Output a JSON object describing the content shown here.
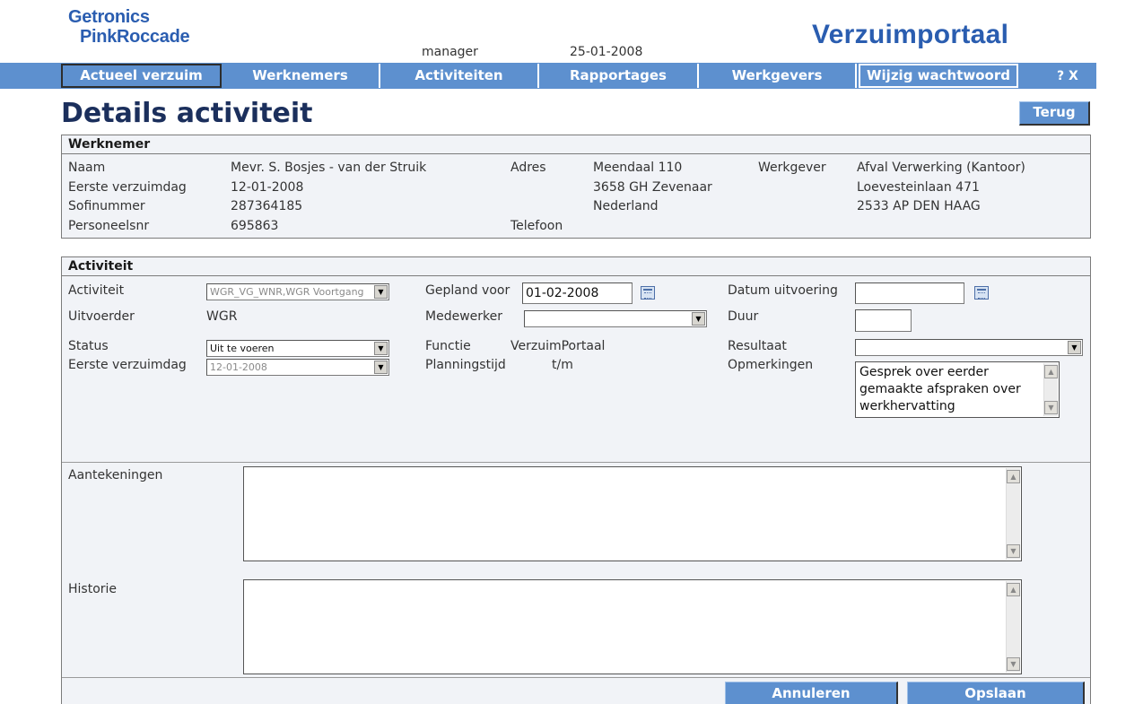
{
  "header": {
    "logo_line1": "Getronics",
    "logo_line2": "PinkRoccade",
    "user": "manager",
    "date": "25-01-2008",
    "portal_title": "Verzuimportaal"
  },
  "nav": {
    "items": [
      {
        "label": "Actueel verzuim"
      },
      {
        "label": "Werknemers"
      },
      {
        "label": "Activiteiten"
      },
      {
        "label": "Rapportages"
      },
      {
        "label": "Werkgevers"
      },
      {
        "label": "Wijzig wachtwoord"
      }
    ],
    "help_close": "? X"
  },
  "page": {
    "title": "Details activiteit",
    "back_label": "Terug"
  },
  "werknemer": {
    "heading": "Werknemer",
    "labels": {
      "naam": "Naam",
      "eerste_verzuimdag": "Eerste verzuimdag",
      "sofinummer": "Sofinummer",
      "personeelsnr": "Personeelsnr",
      "adres": "Adres",
      "telefoon": "Telefoon",
      "werkgever": "Werkgever"
    },
    "values": {
      "naam": "Mevr. S. Bosjes - van der Struik",
      "eerste_verzuimdag": "12-01-2008",
      "sofinummer": "287364185",
      "personeelsnr": "695863",
      "adres_line1": "Meendaal 110",
      "adres_line2": "3658 GH Zevenaar",
      "adres_line3": "Nederland",
      "werkgever_line1": "Afval Verwerking (Kantoor)",
      "werkgever_line2": "Loevesteinlaan 471",
      "werkgever_line3": "2533 AP DEN HAAG"
    }
  },
  "activiteit": {
    "heading": "Activiteit",
    "labels": {
      "activiteit": "Activiteit",
      "uitvoerder": "Uitvoerder",
      "status": "Status",
      "eerste_verzuimdag": "Eerste verzuimdag",
      "gepland_voor": "Gepland voor",
      "medewerker": "Medewerker",
      "functie": "Functie",
      "planningstijd": "Planningstijd",
      "datum_uitvoering": "Datum uitvoering",
      "duur": "Duur",
      "resultaat": "Resultaat",
      "opmerkingen": "Opmerkingen",
      "aantekeningen": "Aantekeningen",
      "historie": "Historie"
    },
    "values": {
      "activiteit_select": "WGR_VG_WNR,WGR Voortgang",
      "uitvoerder": "WGR",
      "status_select": "Uit te voeren",
      "eerste_verzuimdag_select": "12-01-2008",
      "gepland_voor": "01-02-2008",
      "medewerker_select": "",
      "functie": "VerzuimPortaal",
      "planningstijd": "t/m",
      "datum_uitvoering": "",
      "duur": "",
      "resultaat_select": "",
      "opmerkingen": "Gesprek over eerder gemaakte afspraken over werkhervatting",
      "aantekeningen": "",
      "historie": ""
    }
  },
  "footer": {
    "cancel_label": "Annuleren",
    "save_label": "Opslaan"
  },
  "colors": {
    "nav_blue": "#5d90cf",
    "title_navy": "#1b2f5c",
    "brand_blue": "#2a5db0",
    "panel_bg": "#f1f3f7"
  }
}
